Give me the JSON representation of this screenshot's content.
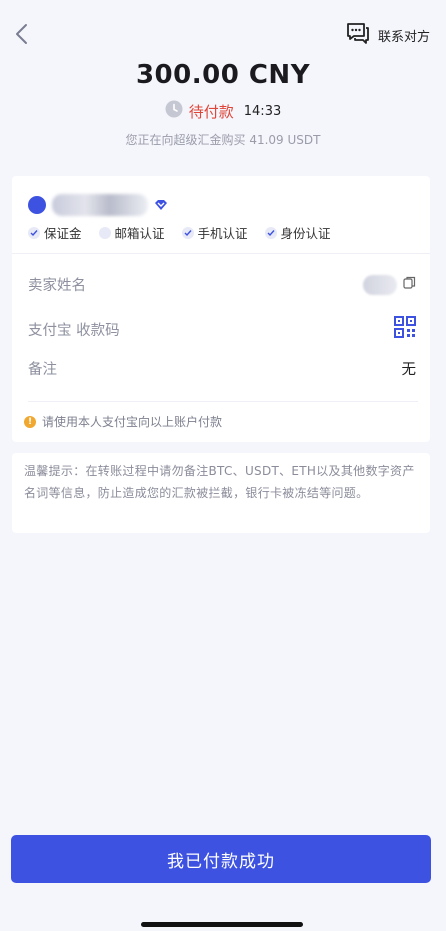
{
  "header": {
    "contact_label": "联系对方"
  },
  "order": {
    "amount": "300.00 CNY",
    "status": "待付款",
    "countdown": "14:33",
    "subtitle": "您正在向超级汇金购买 41.09 USDT"
  },
  "seller": {
    "badges": [
      "保证金",
      "邮箱认证",
      "手机认证",
      "身份认证"
    ]
  },
  "details": {
    "name_label": "卖家姓名",
    "pay_label": "支付宝 收款码",
    "note_label": "备注",
    "note_value": "无",
    "tip": "请使用本人支付宝向以上账户付款"
  },
  "notice": "温馨提示：在转账过程中请勿备注BTC、USDT、ETH以及其他数字资产名词等信息，防止造成您的汇款被拦截，银行卡被冻结等问题。",
  "actions": {
    "paid_button": "我已付款成功"
  },
  "colors": {
    "accent": "#3d52e0",
    "status_red": "#e0453a",
    "background": "#f5f6fb"
  }
}
